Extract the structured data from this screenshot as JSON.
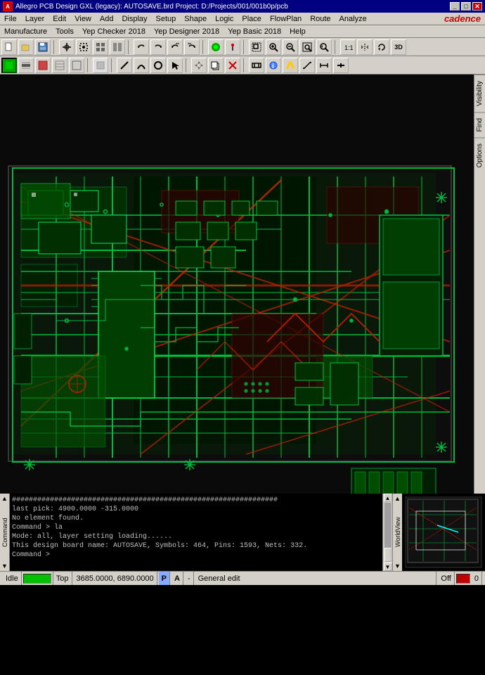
{
  "titlebar": {
    "title": "Allegro PCB Design GXL (legacy): AUTOSAVE.brd   Project: D:/Projects/001/001b0p/pcb",
    "logo": "A",
    "controls": [
      "_",
      "□",
      "✕"
    ]
  },
  "menubar": {
    "items": [
      "File",
      "Layer",
      "Edit",
      "View",
      "Add",
      "Display",
      "Setup",
      "Shape",
      "Logic",
      "Place",
      "FlowPlan",
      "Route",
      "Analyze"
    ],
    "items2": [
      "Manufacture",
      "Tools",
      "Yep Checker 2018",
      "Yep Designer 2018",
      "Yep Basic 2018",
      "Help"
    ],
    "brand": "cadence"
  },
  "console": {
    "lines": [
      "###############################################################",
      "last pick:  4900.0000 -315.0000",
      "No element found.",
      "Command > la",
      "Mode: all, layer setting loading......",
      "This design board name: AUTOSAVE, Symbols: 464, Pins: 1593, Nets: 332.",
      "Command >"
    ],
    "label": "Command"
  },
  "statusbar": {
    "idle": "Idle",
    "layer": "Top",
    "coords": "3685.0000, 6890.0000",
    "p_indicator": "P",
    "a_indicator": "A",
    "dash": "-",
    "mode": "General edit",
    "off": "Off",
    "num": "0"
  },
  "right_tabs": [
    "Visibility",
    "Find",
    "Options"
  ],
  "toolbar1_buttons": [
    "new",
    "open",
    "save",
    "t1",
    "t2",
    "t3",
    "t4",
    "t5",
    "t6",
    "t7",
    "t8",
    "t9",
    "t10",
    "t11",
    "t12",
    "t13",
    "t14",
    "t15",
    "t16",
    "t17",
    "t18",
    "t19",
    "t20",
    "t21",
    "t22",
    "3D"
  ],
  "toolbar2_buttons": [
    "b1",
    "b2",
    "b3",
    "b4",
    "b5",
    "b6",
    "b7",
    "b8",
    "b9",
    "b10",
    "b11",
    "b12",
    "b13",
    "b14",
    "b15",
    "b16",
    "b17",
    "b18",
    "b19",
    "b20",
    "b21",
    "b22"
  ]
}
